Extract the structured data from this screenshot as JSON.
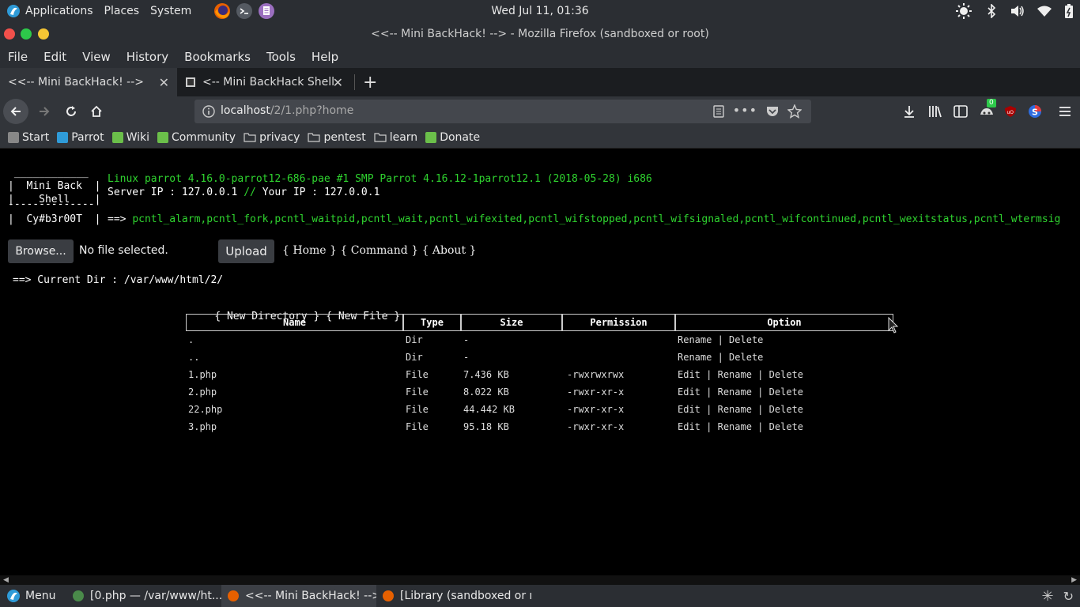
{
  "top_panel": {
    "applications": "Applications",
    "places": "Places",
    "system": "System",
    "clock": "Wed Jul 11, 01:36"
  },
  "window": {
    "title": "<<-- Mini BackHack! --> - Mozilla Firefox (sandboxed or root)"
  },
  "menubar": {
    "items": [
      "File",
      "Edit",
      "View",
      "History",
      "Bookmarks",
      "Tools",
      "Help"
    ]
  },
  "tabs": [
    {
      "label": "<<-- Mini BackHack! -->"
    },
    {
      "label": "<-- Mini BackHack Shell -"
    }
  ],
  "urlbar": {
    "host": "localhost",
    "path": "/2/1.php?home"
  },
  "toolbar_badge": "0",
  "bookmarks": [
    "Start",
    "Parrot",
    "Wiki",
    "Community",
    "privacy",
    "pentest",
    "learn",
    "Donate"
  ],
  "shell": {
    "logo_top": " ____________",
    "logo_line1": "|  Mini Back  |",
    "logo_line2": "|    Shell    |",
    "logo_sep": "--------------",
    "logo_line3": "|  Cy#b3r00T  |",
    "uname": "Linux parrot 4.16.0-parrot12-686-pae #1 SMP Parrot 4.16.12-1parrot12.1 (2018-05-28) i686",
    "server_ip_label": "Server IP : ",
    "server_ip": "127.0.0.1",
    "sep": " // ",
    "your_ip_label": "Your IP : ",
    "your_ip": "127.0.0.1",
    "arrow": "==> ",
    "disabled_functions": "pcntl_alarm,pcntl_fork,pcntl_waitpid,pcntl_wait,pcntl_wifexited,pcntl_wifstopped,pcntl_wifsignaled,pcntl_wifcontinued,pcntl_wexitstatus,pcntl_wtermsig"
  },
  "upload": {
    "browse_label": "Browse...",
    "no_file": "No file selected.",
    "upload_label": "Upload"
  },
  "nav_links": {
    "home": "{ Home }",
    "command": "{ Command }",
    "about": "{ About }"
  },
  "current_dir": {
    "label": "==> Current Dir : ",
    "path": "/var/www/html/2/"
  },
  "actions": {
    "new_directory": "{ New Directory }",
    "new_file": "{ New File }"
  },
  "table": {
    "headers": [
      "Name",
      "Type",
      "Size",
      "Permission",
      "Option"
    ],
    "rows": [
      {
        "name": ".",
        "type": "Dir",
        "size": "-",
        "perm": "",
        "options": [
          "Rename",
          "Delete"
        ]
      },
      {
        "name": "..",
        "type": "Dir",
        "size": "-",
        "perm": "",
        "options": [
          "Rename",
          "Delete"
        ]
      },
      {
        "name": "1.php",
        "type": "File",
        "size": "7.436 KB",
        "perm": "-rwxrwxrwx",
        "options": [
          "Edit",
          "Rename",
          "Delete"
        ]
      },
      {
        "name": "2.php",
        "type": "File",
        "size": "8.022 KB",
        "perm": "-rwxr-xr-x",
        "options": [
          "Edit",
          "Rename",
          "Delete"
        ]
      },
      {
        "name": "22.php",
        "type": "File",
        "size": "44.442 KB",
        "perm": "-rwxr-xr-x",
        "options": [
          "Edit",
          "Rename",
          "Delete"
        ]
      },
      {
        "name": "3.php",
        "type": "File",
        "size": "95.18 KB",
        "perm": "-rwxr-xr-x",
        "options": [
          "Edit",
          "Rename",
          "Delete"
        ]
      }
    ]
  },
  "taskbar": {
    "menu": "Menu",
    "items": [
      "[0.php — /var/www/ht...",
      "<<-- Mini BackHack! -->...",
      "[Library (sandboxed or r..."
    ]
  },
  "colors": {
    "panel_bg": "#2b2e33",
    "toolbar_bg": "#32353a",
    "shell_green": "#2fd42f",
    "close": "#f2504b",
    "minimize": "#2dc94a",
    "maximize": "#f5c534"
  }
}
